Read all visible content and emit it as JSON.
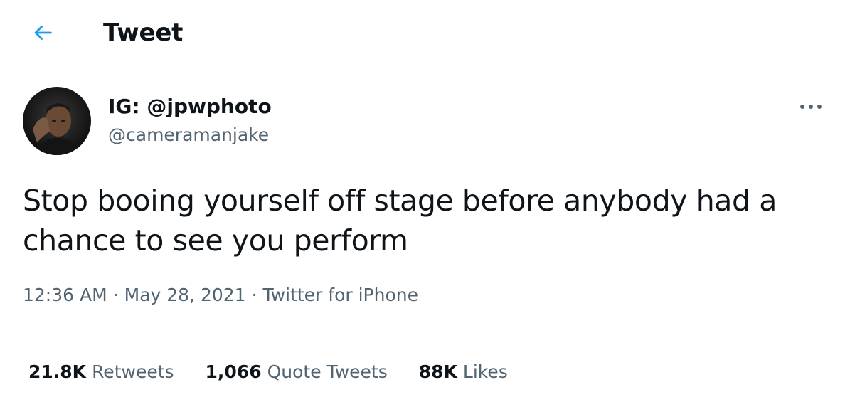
{
  "header": {
    "title": "Tweet",
    "back_icon": "arrow-left-icon",
    "accent_color": "#1d9bf0"
  },
  "user": {
    "display_name": "IG: @jpwphoto",
    "handle": "@cameramanjake",
    "avatar_icon": "profile-photo"
  },
  "tweet": {
    "text": "Stop booing yourself off stage before anybody had a\nchance to see you perform",
    "more_icon": "more-horizontal-icon"
  },
  "meta": {
    "time": "12:36 AM",
    "separator": "·",
    "date": "May 28, 2021",
    "source": "Twitter for iPhone"
  },
  "stats": {
    "retweets": {
      "count": "21.8K",
      "label": "Retweets"
    },
    "quotes": {
      "count": "1,066",
      "label": "Quote Tweets"
    },
    "likes": {
      "count": "88K",
      "label": "Likes"
    }
  }
}
